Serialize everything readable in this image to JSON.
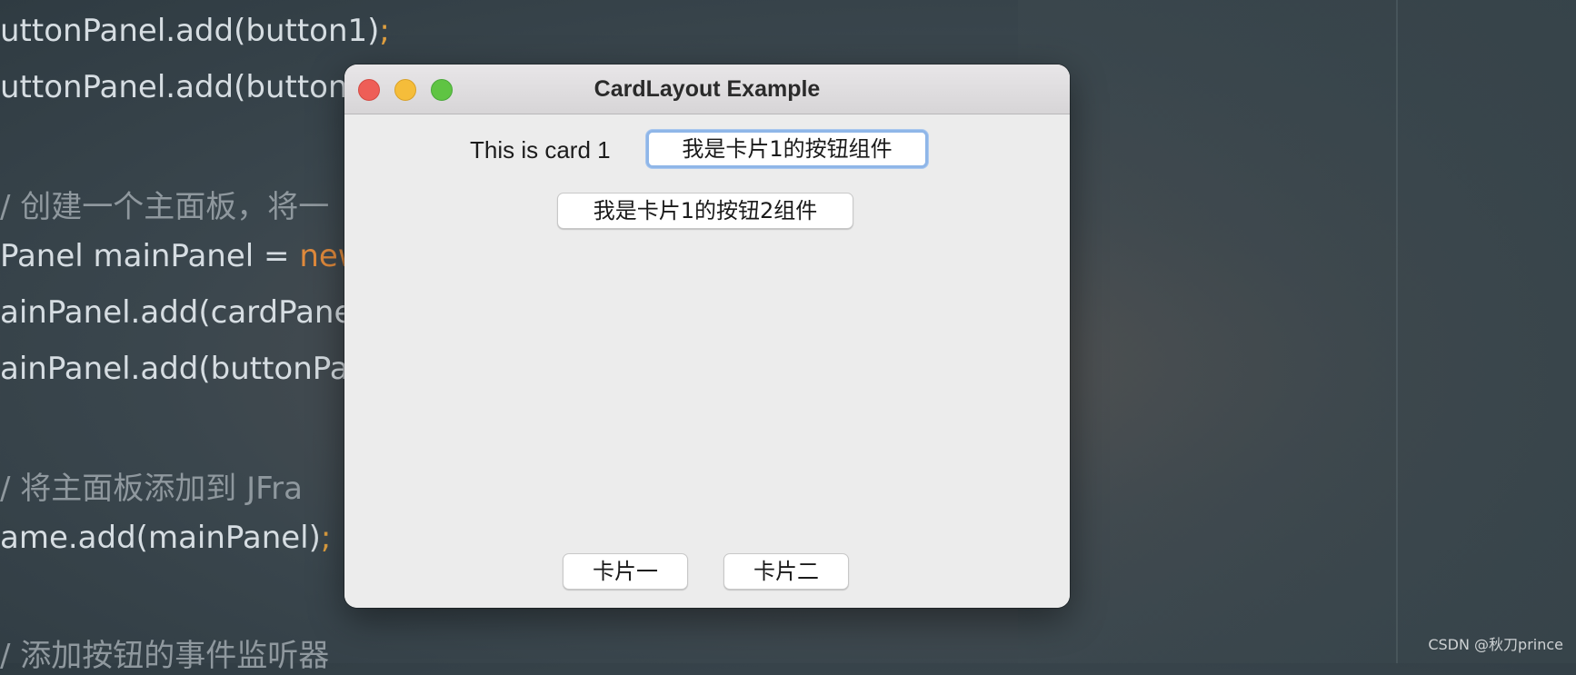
{
  "background": {
    "code_lines": [
      {
        "segments": [
          {
            "text": "uttonPanel.add(button1)",
            "cls": ""
          },
          {
            "text": ";",
            "cls": "semi"
          }
        ],
        "comment": false
      },
      {
        "segments": [
          {
            "text": "uttonPanel.add(button",
            "cls": ""
          }
        ],
        "comment": false
      },
      {
        "segments": [
          {
            "text": "/ 创建一个主面板，将一",
            "cls": ""
          }
        ],
        "comment": true
      },
      {
        "segments": [
          {
            "text": "Panel mainPanel = ",
            "cls": ""
          },
          {
            "text": "new",
            "cls": "kw"
          }
        ],
        "comment": false
      },
      {
        "segments": [
          {
            "text": "ainPanel.add(cardPane",
            "cls": ""
          }
        ],
        "comment": false
      },
      {
        "segments": [
          {
            "text": "ainPanel.add(buttonPa",
            "cls": ""
          }
        ],
        "comment": false
      },
      {
        "segments": [
          {
            "text": "/ 将主面板添加到 JFra",
            "cls": ""
          }
        ],
        "comment": true
      },
      {
        "segments": [
          {
            "text": "ame.add(mainPanel)",
            "cls": ""
          },
          {
            "text": ";",
            "cls": "semi"
          }
        ],
        "comment": false
      },
      {
        "segments": [
          {
            "text": "/ 添加按钮的事件监听器",
            "cls": ""
          }
        ],
        "comment": true
      }
    ],
    "watermark": "CSDN @秋刀prince"
  },
  "window": {
    "title": "CardLayout Example",
    "traffic_lights": [
      "close-button",
      "minimize-button",
      "maximize-button"
    ],
    "card": {
      "label": "This is card 1",
      "button1_label": "我是卡片1的按钮组件",
      "button2_label": "我是卡片1的按钮2组件"
    },
    "controls": {
      "card1_label": "卡片一",
      "card2_label": "卡片二"
    }
  },
  "colors": {
    "close": "#ee5e57",
    "minimize": "#f5bd3a",
    "maximize": "#5fc443",
    "focus_ring": "#8fb6e8",
    "keyword": "#e08a3c"
  }
}
